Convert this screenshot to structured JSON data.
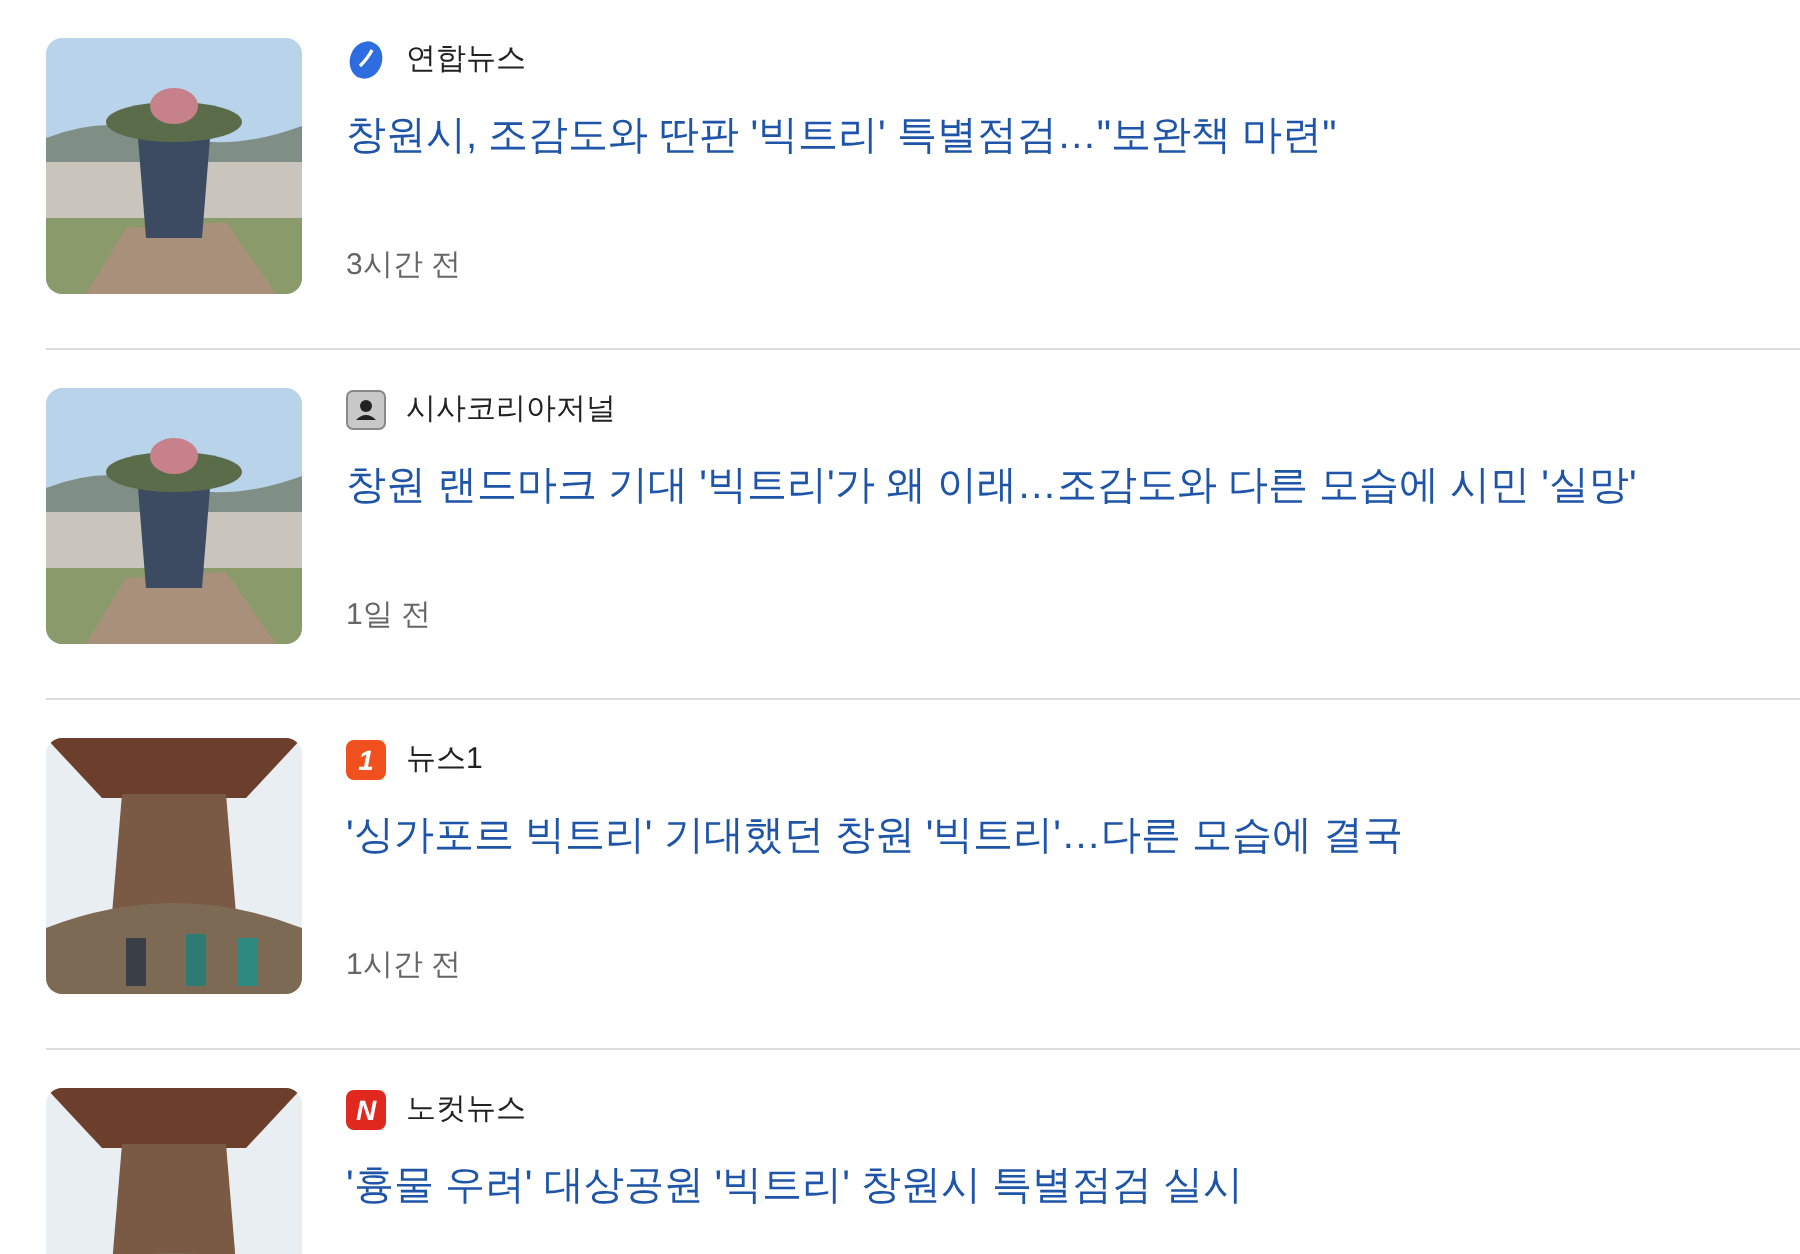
{
  "articles": [
    {
      "source": {
        "name": "연합뉴스",
        "kind": "swirl"
      },
      "title": "창원시, 조감도와 딴판 '빅트리' 특별점검…\"보완책 마련\"",
      "time": "3시간 전"
    },
    {
      "source": {
        "name": "시사코리아저널",
        "kind": "badge"
      },
      "title": "창원 랜드마크 기대 '빅트리'가 왜 이래…조감도와 다른 모습에 시민 '실망'",
      "time": "1일 전"
    },
    {
      "source": {
        "name": "뉴스1",
        "kind": "letter",
        "mark": "1",
        "color": "#f0501e"
      },
      "title": "'싱가포르 빅트리' 기대했던 창원 '빅트리'…다른 모습에 결국",
      "time": "1시간 전"
    },
    {
      "source": {
        "name": "노컷뉴스",
        "kind": "letter",
        "mark": "N",
        "color": "#e0281e"
      },
      "title": "'흉물 우려' 대상공원 '빅트리' 창원시 특별점검 실시"
    }
  ]
}
